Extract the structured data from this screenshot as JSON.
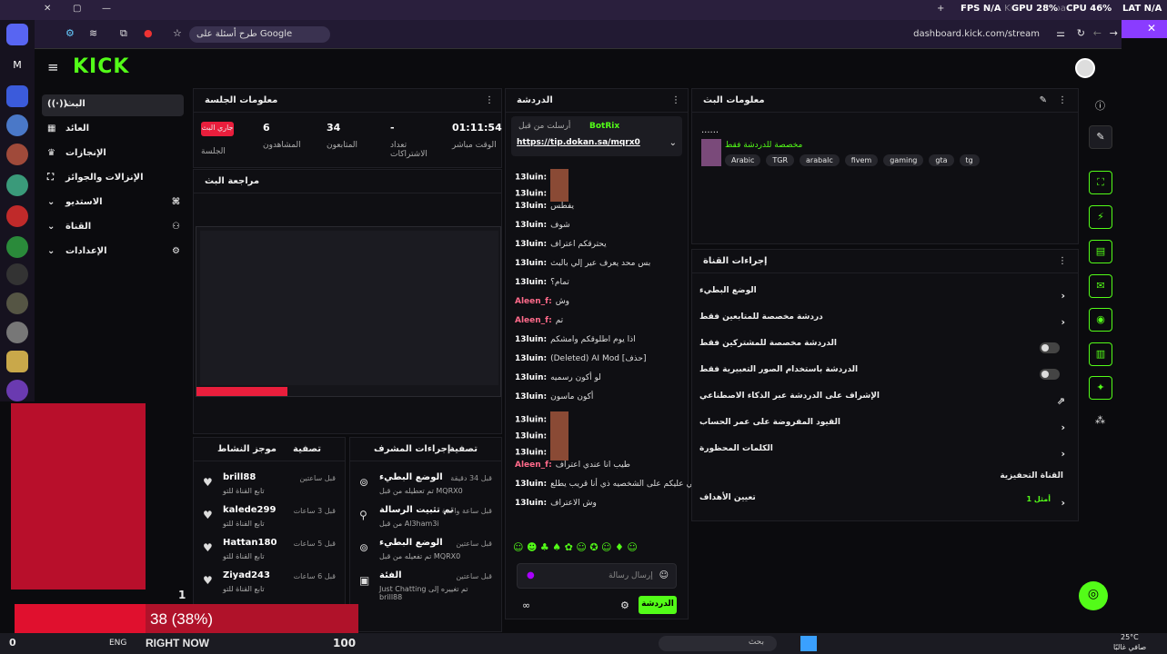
{
  "browser": {
    "tab_title": "Stream - Kick Dashboard",
    "fps": "FPS N/A",
    "gpu": "GPU 28%",
    "cpu": "CPU 46%",
    "lat": "LAT N/A",
    "ask_pill": "طرح أسئلة على Google",
    "url": "dashboard.kick.com/stream"
  },
  "nav": {
    "logo": "KICK",
    "items": [
      {
        "label": "البث"
      },
      {
        "label": "العائد"
      },
      {
        "label": "الإنجازات"
      },
      {
        "label": "الإنزالات والجوائز"
      },
      {
        "label": "الاستديو"
      },
      {
        "label": "القناة"
      },
      {
        "label": "الإعدادات"
      }
    ]
  },
  "session": {
    "title": "معلومات الجلسة",
    "live_badge": "جاري البث",
    "session_label": "الجلسة",
    "viewers": "6",
    "viewers_label": "المشاهدون",
    "followers": "34",
    "followers_label": "المتابعون",
    "subs": "-",
    "subs_label": "تعداد الاشتراكات",
    "duration": "01:11:54",
    "duration_label": "الوقت مباشر"
  },
  "preview": {
    "title": "مراجعة البث"
  },
  "chat": {
    "title": "الدردشة",
    "pinned_user": "BotRix",
    "pinned_meta": "أرسلت من قبل",
    "pinned_link": "https://tip.dokan.sa/mqrx0",
    "messages": [
      {
        "u": "13luin:",
        "t": "",
        "img": true
      },
      {
        "u": "13luin:",
        "t": "",
        "img": true
      },
      {
        "u": "13luin:",
        "t": "يفطس"
      },
      {
        "u": "13luin:",
        "t": "شوف"
      },
      {
        "u": "13luin:",
        "t": "يحترقكم اعتراف"
      },
      {
        "u": "13luin:",
        "t": "بس محد يعرف عير إلي بالبث"
      },
      {
        "u": "13luin:",
        "t": "تمام؟"
      },
      {
        "u": "Aleen_f:",
        "t": "وش",
        "p": true
      },
      {
        "u": "Aleen_f:",
        "t": "تم",
        "p": true
      },
      {
        "u": "13luin:",
        "t": "اذا يوم اطلوقكم وامشكم"
      },
      {
        "u": "13luin:",
        "t": "(Deleted) AI Mod [حذف]"
      },
      {
        "u": "13luin:",
        "t": "لو أكون رسميه"
      },
      {
        "u": "13luin:",
        "t": "أكون ماسون"
      },
      {
        "u": "13luin:",
        "t": "",
        "img": true
      },
      {
        "u": "13luin:",
        "t": "",
        "img": true
      },
      {
        "u": "13luin:",
        "t": "",
        "img": true
      },
      {
        "u": "Aleen_f:",
        "t": "طيب انا عندي اعتراف",
        "p": true
      },
      {
        "u": "13luin:",
        "t": "يحي عليكم على الشخصيه ذي أنا قريب يطلع"
      },
      {
        "u": "13luin:",
        "t": "وش الاعتراف"
      }
    ],
    "input_placeholder": "إرسال رسالة",
    "send_label": "الدردشة"
  },
  "stream_info": {
    "title": "معلومات البث",
    "dots": "......",
    "category": "مخصصة للدردشة فقط",
    "tags": [
      "Arabic",
      "TGR",
      "arabalc",
      "fivem",
      "gaming",
      "gta",
      "tg"
    ]
  },
  "channel_actions": {
    "title": "إجراءات القناة",
    "items": [
      {
        "label": "الوضع البطيء",
        "type": "chevron"
      },
      {
        "label": "دردشة مخصصة للمتابعين فقط",
        "type": "chevron"
      },
      {
        "label": "الدردشة مخصصة للمشتركين فقط",
        "type": "toggle"
      },
      {
        "label": "الدردشة باستخدام الصور التعبيرية فقط",
        "type": "toggle"
      },
      {
        "label": "الإشراف على الدردشة عبر الذكاء الاصطناعي",
        "type": "icon"
      },
      {
        "label": "القيود المفروضة على عمر الحساب",
        "type": "chevron"
      },
      {
        "label": "الكلمات المحظورة",
        "type": "chevron"
      }
    ],
    "goal_section": "القناة التحفيزية",
    "goal_label": "تعيين الأهداف",
    "goal_status": "أمثل 1"
  },
  "activity": {
    "title": "موجز النشاط",
    "filter": "تصفية",
    "items": [
      {
        "name": "brill88",
        "sub": "تابع القناة للتو",
        "time": "قبل ساعتين"
      },
      {
        "name": "kalede299",
        "sub": "تابع القناة للتو",
        "time": "قبل 3 ساعات"
      },
      {
        "name": "Hattan180",
        "sub": "تابع القناة للتو",
        "time": "قبل 5 ساعات"
      },
      {
        "name": "Ziyad243",
        "sub": "تابع القناة للتو",
        "time": "قبل 6 ساعات"
      }
    ]
  },
  "mod": {
    "title": "إجراءات المشرف",
    "filter": "تصفية",
    "items": [
      {
        "name": "الوضع البطيء",
        "sub": "تم تعطيله من قبل MQRX0",
        "time": "قبل 34 دقيقة"
      },
      {
        "name": "تم تثبيت الرسالة",
        "sub": "من قبل Al3ham3i",
        "time": "قبل ساعة واحدة"
      },
      {
        "name": "الوضع البطيء",
        "sub": "تم تفعيله من قبل MQRX0",
        "time": "قبل ساعتين"
      },
      {
        "name": "الفئة",
        "sub": "Just Chatting تم تغييره إلى brill88",
        "time": "قبل ساعتين"
      }
    ]
  },
  "overlay": {
    "progress_text": "38 (38%)",
    "progress_fraction": 0.38,
    "right_now": "RIGHT NOW",
    "right_value": "100",
    "counter": "1",
    "left_value": "0"
  },
  "taskbar": {
    "search": "بحث",
    "weather": "25°C",
    "weather_sub": "صافي غالبًا",
    "lang": "ENG"
  },
  "colors": {
    "accent": "#53fc18",
    "live": "#e91e3c",
    "bg": "#0b0b0e"
  }
}
